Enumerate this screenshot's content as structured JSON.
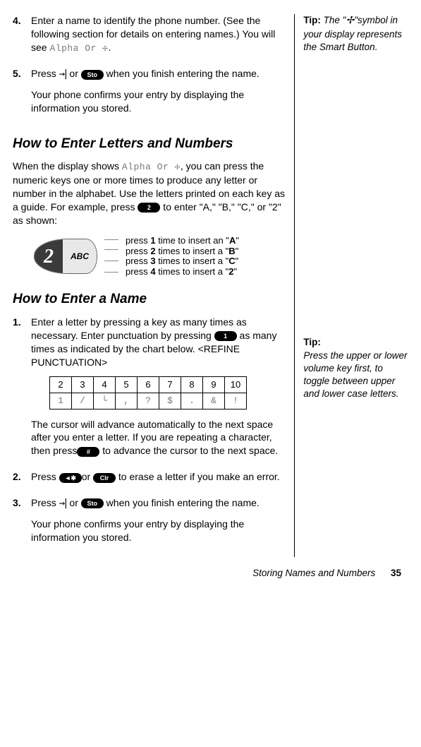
{
  "step4": {
    "num": "4.",
    "text_a": "Enter a name to identify the phone number. (See the following section for details on entering names.) You will see ",
    "lcd": "Alpha Or ✢",
    "text_b": "."
  },
  "step5": {
    "num": "5.",
    "text_a": "Press ",
    "arrow": "→|",
    "or": " or ",
    "btn": "Sto",
    "text_b": " when you finish entering the name.",
    "confirm": "Your phone confirms your entry by displaying the information you stored."
  },
  "section1": {
    "title": "How to Enter Letters and Numbers",
    "intro_a": "When the display shows ",
    "intro_lcd": "Alpha Or ✢",
    "intro_b": ", you can press the numeric keys one or more times to produce any letter or number in the alphabet. Use the letters printed on each key as a guide. For example, press ",
    "intro_btn": "2",
    "intro_c": " to enter \"A,\" \"B,\" \"C,\" or \"2\" as shown:"
  },
  "keyfig": {
    "digit": "2",
    "letters": "ABC",
    "lines": [
      {
        "a": "press ",
        "n": "1",
        "b": " time to insert an \"",
        "c": "A",
        "d": "\""
      },
      {
        "a": "press ",
        "n": "2",
        "b": " times to insert a \"",
        "c": "B",
        "d": "\""
      },
      {
        "a": "press ",
        "n": "3",
        "b": " times to insert a \"",
        "c": "C",
        "d": "\""
      },
      {
        "a": "press ",
        "n": "4",
        "b": " times to insert a \"",
        "c": "2",
        "d": "\""
      }
    ]
  },
  "section2": {
    "title": "How to Enter a Name"
  },
  "name_step1": {
    "num": "1.",
    "text_a": "Enter a letter by pressing a key as many times as necessary. Enter punctuation by pressing ",
    "btn": "1",
    "text_b": " as many times as indicated by the chart below. <REFINE PUNCTUATION>"
  },
  "punct_table": {
    "head": [
      "2",
      "3",
      "4",
      "5",
      "6",
      "7",
      "8",
      "9",
      "10"
    ],
    "row": [
      "1",
      "/",
      "└",
      ",",
      "?",
      "$",
      ".",
      "&",
      "!"
    ]
  },
  "name_step1_after": {
    "text_a": "The cursor will advance automatically to the next space after you enter a letter. If you are repeating a character, then press",
    "btn": "#",
    "text_b": " to advance the cursor to the next space."
  },
  "name_step2": {
    "num": "2.",
    "text_a": "Press ",
    "btn1": "◄✱",
    "or": "or ",
    "btn2": "Clr",
    "text_b": " to erase a letter if you make an error."
  },
  "name_step3": {
    "num": "3.",
    "text_a": "Press ",
    "arrow": "→|",
    "or": " or ",
    "btn": "Sto",
    "text_b": " when you finish entering the name.",
    "confirm": "Your phone confirms your entry by displaying the information you stored."
  },
  "tip1": {
    "label": "Tip:",
    "body_a": " The \"",
    "sym": "✢",
    "body_b": "\"symbol in your display represents the Smart Button."
  },
  "tip2": {
    "label": "Tip:",
    "body": "Press the upper or lower volume key first, to toggle between upper and lower case letters."
  },
  "footer": {
    "section": "Storing Names and Numbers",
    "page": "35"
  }
}
